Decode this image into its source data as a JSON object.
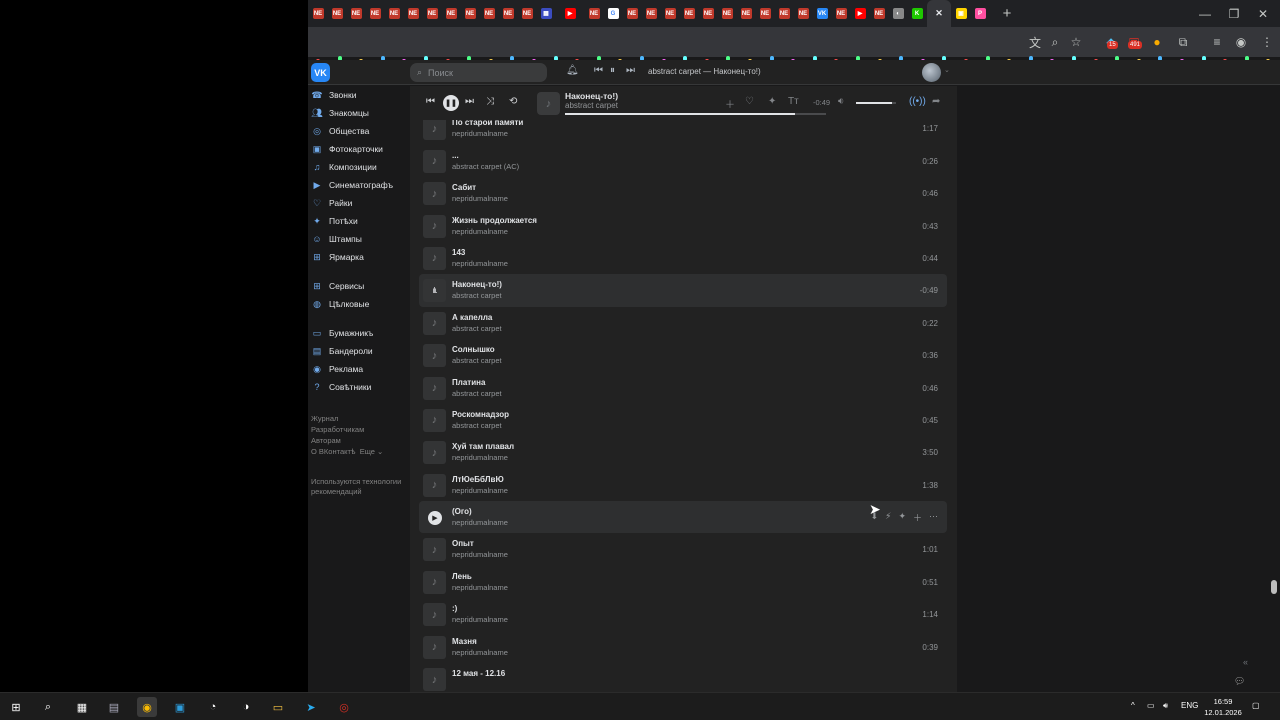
{
  "browser": {
    "tab_icons": [
      "NE",
      "NE",
      "NE",
      "NE",
      "NE",
      "NE",
      "NE",
      "NE",
      "NE",
      "NE",
      "NE",
      "NE",
      "pin",
      "yt",
      "NE",
      "google",
      "NE",
      "NE",
      "NE",
      "NE",
      "NE",
      "NE",
      "NE",
      "NE",
      "NE",
      "NE",
      "VK",
      "NE",
      "yt",
      "NE",
      "chrome",
      "kinopoisk",
      "x",
      "yellow",
      "pink"
    ],
    "new_tab_label": "+",
    "window_controls": {
      "minimize": "—",
      "maximize": "❐",
      "close": "✕"
    },
    "badges": {
      "ext1": "15",
      "ext2": "491"
    }
  },
  "vk": {
    "logo": "VK",
    "search_placeholder": "Поиск",
    "header_track": "abstract carpet — Наконец-то!)"
  },
  "nav": {
    "items": [
      {
        "icon": "phone-icon",
        "label": "Звонки"
      },
      {
        "icon": "users-icon",
        "label": "Знакомцы"
      },
      {
        "icon": "community-icon",
        "label": "Общества"
      },
      {
        "icon": "photo-icon",
        "label": "Фотокарточки"
      },
      {
        "icon": "music-icon",
        "label": "Композиции"
      },
      {
        "icon": "video-icon",
        "label": "Синематографъ"
      },
      {
        "icon": "like-icon",
        "label": "Райки"
      },
      {
        "icon": "games-icon",
        "label": "Потѣхи"
      },
      {
        "icon": "stickers-icon",
        "label": "Штампы"
      },
      {
        "icon": "market-icon",
        "label": "Ярмарка"
      }
    ],
    "items2": [
      {
        "icon": "services-icon",
        "label": "Сервисы"
      },
      {
        "icon": "coins-icon",
        "label": "Цѣлковые"
      }
    ],
    "items3": [
      {
        "icon": "wallet-icon",
        "label": "Бумажникъ"
      },
      {
        "icon": "ads-icon",
        "label": "Бандероли"
      },
      {
        "icon": "promo-icon",
        "label": "Реклама"
      },
      {
        "icon": "help-icon",
        "label": "Совѣтники"
      }
    ],
    "footer": [
      "Журнал",
      "Разработчикам",
      "Авторам",
      "О ВКонтактѣ"
    ],
    "footer_more": "Еще ⌄",
    "footer_note": "Используются технологии рекомендаций"
  },
  "player": {
    "title": "Наконец-то!)",
    "artist": "abstract carpet",
    "time": "-0:49",
    "progress": 0.88,
    "volume": 0.9
  },
  "tracks": [
    {
      "title": "",
      "artist": "abstract carpet (AC)",
      "duration": "",
      "state": "partial"
    },
    {
      "title": "По старой памяти",
      "artist": "nepridumalname",
      "duration": "1:17"
    },
    {
      "title": "...",
      "artist": "abstract carpet (AC)",
      "duration": "0:26"
    },
    {
      "title": "Сабит",
      "artist": "nepridumalname",
      "duration": "0:46"
    },
    {
      "title": "Жизнь продолжается",
      "artist": "nepridumalname",
      "duration": "0:43"
    },
    {
      "title": "143",
      "artist": "nepridumalname",
      "duration": "0:44"
    },
    {
      "title": "Наконец-то!)",
      "artist": "abstract carpet",
      "duration": "-0:49",
      "state": "current"
    },
    {
      "title": "А капелла",
      "artist": "abstract carpet",
      "duration": "0:22"
    },
    {
      "title": "Солнышко",
      "artist": "abstract carpet",
      "duration": "0:36"
    },
    {
      "title": "Платина",
      "artist": "abstract carpet",
      "duration": "0:46"
    },
    {
      "title": "Роскомнадзор",
      "artist": "abstract carpet",
      "duration": "0:45"
    },
    {
      "title": "Хуй там плавал",
      "artist": "nepridumalname",
      "duration": "3:50"
    },
    {
      "title": "ЛтЮеБбЛвЮ",
      "artist": "nepridumalname",
      "duration": "1:38"
    },
    {
      "title": "(Ого)",
      "artist": "nepridumalname",
      "duration": "",
      "state": "hover"
    },
    {
      "title": "Опыт",
      "artist": "nepridumalname",
      "duration": "1:01"
    },
    {
      "title": "Лень",
      "artist": "nepridumalname",
      "duration": "0:51"
    },
    {
      "title": ":)",
      "artist": "nepridumalname",
      "duration": "1:14"
    },
    {
      "title": "Мазня",
      "artist": "nepridumalname",
      "duration": "0:39"
    },
    {
      "title": "12 мая - 12.16",
      "artist": "",
      "duration": "",
      "state": "partial"
    }
  ],
  "taskbar": {
    "apps": [
      "windows-icon",
      "search-icon",
      "explorer-icon",
      "calculator-icon",
      "chrome-icon",
      "app-icon",
      "steam-icon",
      "steam-vr-icon",
      "folder-icon",
      "telegram-icon",
      "obs-icon"
    ],
    "lang": "ENG",
    "time": "16:59",
    "date": "12.01.2026"
  },
  "colors": {
    "accent": "#2787f5",
    "link": "#71aaeb",
    "bg": "#19191a",
    "panel": "#222222"
  }
}
